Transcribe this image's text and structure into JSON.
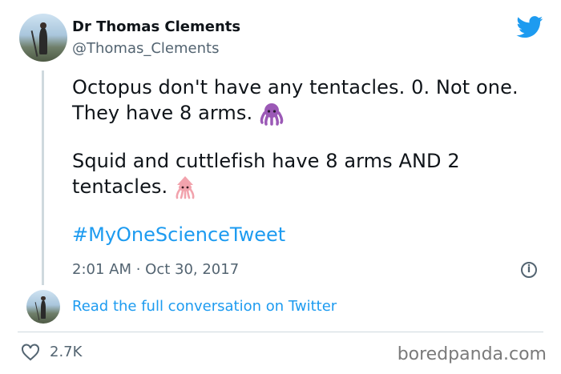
{
  "tweet": {
    "author_name": "Dr Thomas Clements",
    "author_handle": "@Thomas_Clements",
    "lines": [
      "Octopus don't have any tentacles. 0. Not one.",
      "They have 8 arms.",
      "Squid and cuttlefish have 8 arms AND 2",
      "tentacles."
    ],
    "hashtag": "#MyOneScienceTweet",
    "timestamp": "2:01 AM · Oct 30, 2017",
    "likes": "2.7K"
  },
  "footer": {
    "read_more": "Read the full conversation on Twitter"
  },
  "watermark": "boredpanda.com",
  "icons": [
    "twitter-bird-icon",
    "octopus-emoji-icon",
    "squid-emoji-icon",
    "info-icon",
    "heart-icon"
  ],
  "colors": {
    "link": "#1d9bf0",
    "text": "#0f1419",
    "secondary": "#536471",
    "border": "#cfd9de"
  }
}
